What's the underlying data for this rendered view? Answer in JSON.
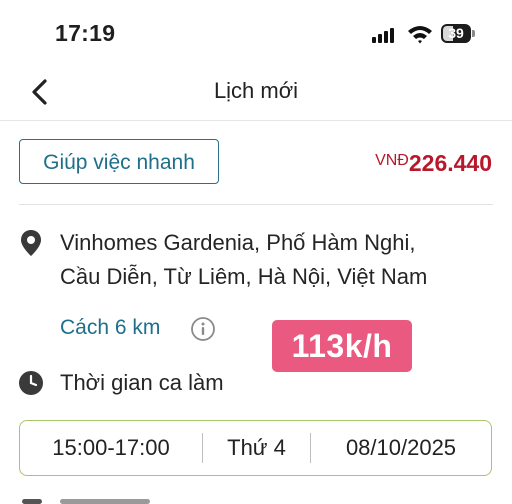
{
  "status_bar": {
    "time": "17:19",
    "battery": "39"
  },
  "header": {
    "title": "Lịch mới"
  },
  "job": {
    "service": "Giúp việc nhanh",
    "price_currency": "VNĐ",
    "price": "226.440"
  },
  "location": {
    "address_line1": "Vinhomes Gardenia, Phố Hàm Nghi,",
    "address_line2": "Cầu Diễn, Từ Liêm, Hà Nội, Việt Nam",
    "distance": "Cách 6 km"
  },
  "overlay": {
    "speed_label": "113k/h"
  },
  "shift": {
    "label": "Thời gian ca làm",
    "time_range": "15:00-17:00",
    "weekday": "Thứ 4",
    "date": "08/10/2025"
  },
  "colors": {
    "accent": "#1f6f8b",
    "price": "#b8182b",
    "badge": "#ea5a80",
    "schedule_border": "#a7c66a"
  },
  "icons": [
    "back-icon",
    "map-pin-icon",
    "info-icon",
    "clock-icon",
    "signal-icon",
    "wifi-icon",
    "battery-icon"
  ]
}
